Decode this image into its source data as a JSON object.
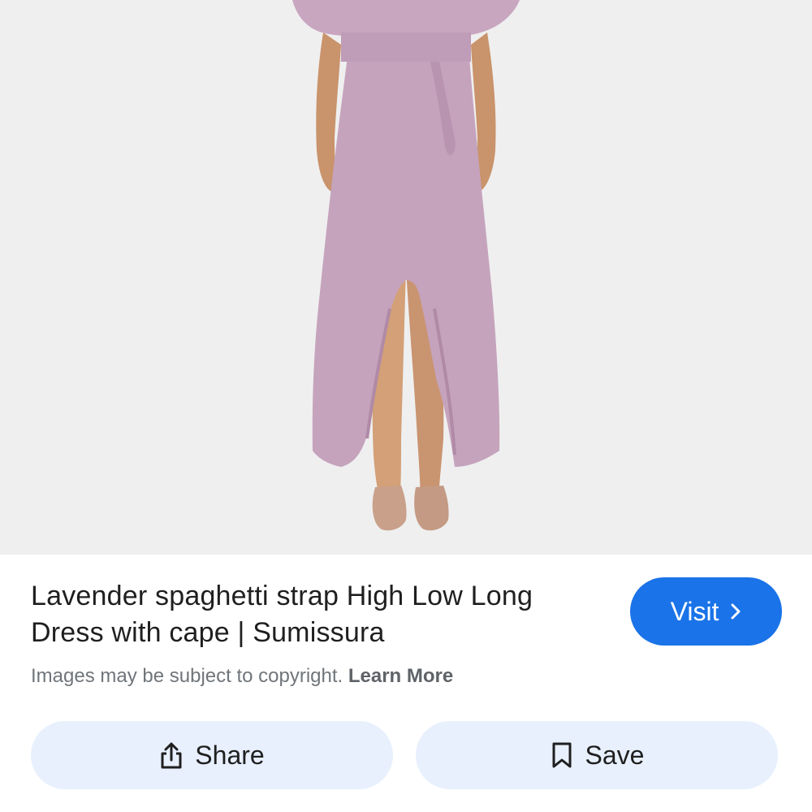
{
  "result": {
    "title": "Lavender spaghetti strap High Low Long Dress with cape | Sumissura",
    "copyright_text": "Images may be subject to copyright.",
    "learn_more_label": "Learn More",
    "visit_label": "Visit",
    "image_alt": "Lavender high low long dress with cape"
  },
  "actions": {
    "share_label": "Share",
    "save_label": "Save"
  },
  "icons": {
    "visit": "chevron-right-icon",
    "share": "share-icon",
    "save": "bookmark-icon"
  },
  "colors": {
    "accent": "#1a73e8",
    "action_bg": "#e8f0fe",
    "dress": "#c5a3bd",
    "photo_bg": "#efefef"
  }
}
